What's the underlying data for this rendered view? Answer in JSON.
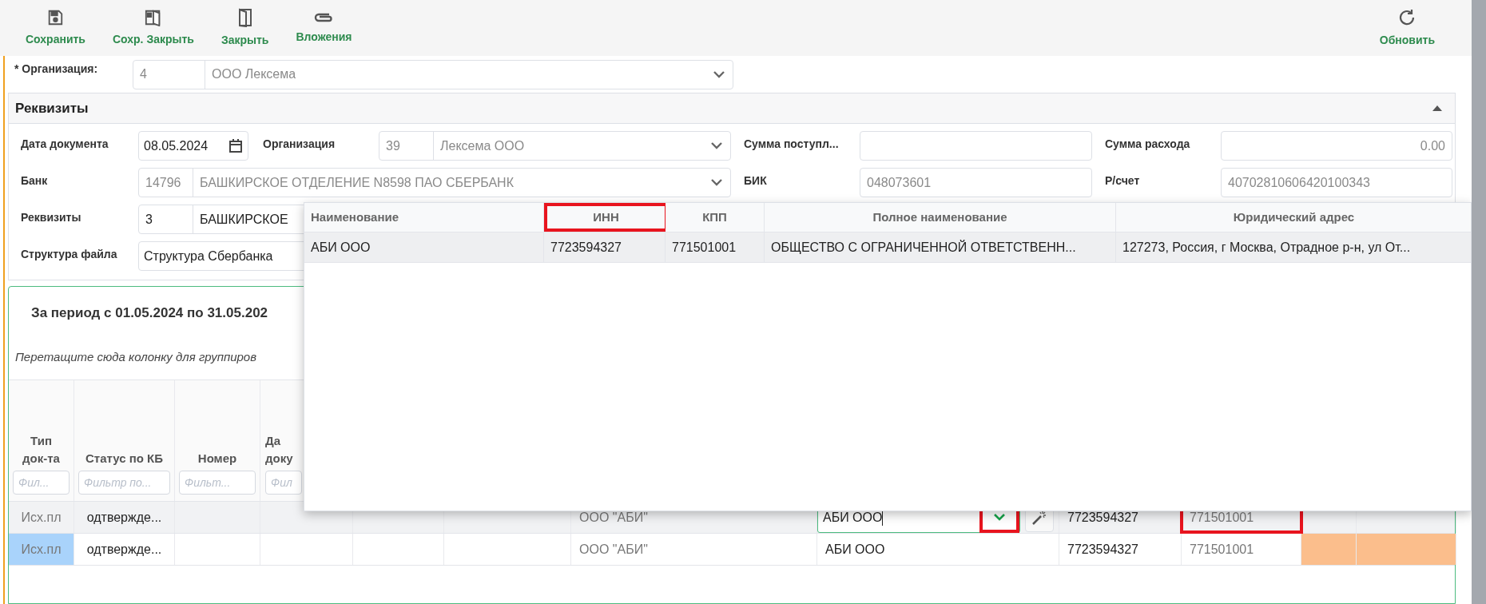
{
  "toolbar": {
    "buttons": [
      {
        "label": "Сохранить"
      },
      {
        "label": "Сохр. Закрыть"
      },
      {
        "label": "Закрыть"
      },
      {
        "label": "Вложения"
      }
    ],
    "right_buttons": [
      {
        "label": "Обновить"
      }
    ]
  },
  "organization": {
    "label": "* Организация:",
    "id": "4",
    "name": "ООО Лексема"
  },
  "requisites": {
    "title": "Реквизиты",
    "expanded": true,
    "rows": [
      [
        {
          "label": "Дата документа",
          "kind": "date",
          "value": "08.05.2024"
        },
        {
          "label": "Организация",
          "kind": "lookup",
          "id": "39",
          "name": "Лексема ООО",
          "disabled": true
        },
        {
          "label": "Сумма поступл...",
          "kind": "text"
        },
        {
          "label": "Сумма расхода",
          "kind": "number",
          "value": "0.00",
          "disabled": true
        }
      ],
      [
        {
          "label": "Банк",
          "kind": "wide-lookup",
          "id": "14796",
          "name": "БАШКИРСКОЕ ОТДЕЛЕНИЕ N8598 ПАО СБЕРБАНК",
          "disabled": true
        },
        "",
        {
          "label": "БИК",
          "kind": "text",
          "value": "048073601",
          "disabled": true
        },
        {
          "label": "Р/счет",
          "kind": "text",
          "value": "40702810606420100343",
          "disabled": true
        }
      ],
      [
        {
          "label": "Реквизиты",
          "kind": "wide-lookup",
          "id": "3",
          "name": "БАШКИРСКОЕ",
          "disabled": false
        }
      ],
      [
        {
          "label": "Структура файла",
          "kind": "wide-text",
          "value": "Структура Сбербанка"
        }
      ]
    ]
  },
  "grid": {
    "title": "За период с 01.05.2024 по 31.05.202",
    "group_hint": "Перетащите сюда колонку для группиров",
    "columns": [
      {
        "header": [
          "Тип",
          "док-та"
        ],
        "placeholder": "Фил..."
      },
      {
        "header": [
          "Статус по КБ"
        ],
        "placeholder": "Фильтр по..."
      },
      {
        "header": [
          "Номер"
        ],
        "placeholder": "Фильт..."
      },
      {
        "header": [
          "Да",
          "доку"
        ],
        "placeholder": "Фил"
      }
    ],
    "rows": [
      {
        "current": true,
        "cells": [
          {
            "kind": "text",
            "text": "Исх.пл",
            "muted": true
          },
          {
            "kind": "text",
            "text": "одтвержде...",
            "muted": false
          },
          {
            "kind": "blank"
          },
          {
            "kind": "blank"
          },
          {
            "kind": "blank"
          },
          {
            "kind": "blank"
          },
          {
            "kind": "text",
            "text": "ООО \"АБИ\"",
            "muted": true
          },
          {
            "kind": "editor",
            "value": "АБИ ООО",
            "highlighted": true
          },
          {
            "kind": "text",
            "text": "7723594327",
            "muted": false
          },
          {
            "kind": "text",
            "text": "771501001",
            "muted": true,
            "highlighted": true
          },
          {
            "kind": "blank"
          },
          {
            "kind": "blank"
          }
        ]
      },
      {
        "current": false,
        "cells": [
          {
            "kind": "text",
            "text": "Исх.пл",
            "muted": true,
            "color": "#a9d3fb"
          },
          {
            "kind": "text",
            "text": "одтвержде...",
            "muted": false
          },
          {
            "kind": "blank"
          },
          {
            "kind": "blank"
          },
          {
            "kind": "blank"
          },
          {
            "kind": "blank"
          },
          {
            "kind": "text",
            "text": "ООО \"АБИ\"",
            "muted": true
          },
          {
            "kind": "text",
            "text": "АБИ ООО",
            "muted": false
          },
          {
            "kind": "text",
            "text": "7723594327",
            "muted": false
          },
          {
            "kind": "text",
            "text": "771501001",
            "muted": true
          },
          {
            "kind": "blank",
            "color": "#fbbe8c"
          },
          {
            "kind": "blank",
            "color": "#fbbe8c"
          }
        ]
      }
    ]
  },
  "dropdown": {
    "columns": [
      {
        "header": "Наименование",
        "highlighted": false
      },
      {
        "header": "ИНН",
        "highlighted": true
      },
      {
        "header": "КПП",
        "highlighted": false
      },
      {
        "header": "Полное наименование",
        "highlighted": false
      },
      {
        "header": "Юридический адрес",
        "highlighted": false
      }
    ],
    "rows": [
      {
        "selected": true,
        "cells": [
          "АБИ ООО",
          "7723594327",
          "771501001",
          "ОБЩЕСТВО С ОГРАНИЧЕННОЙ ОТВЕТСТВЕНН...",
          "127273, Россия, г Москва, Отрадное р-н, ул От..."
        ]
      }
    ]
  }
}
